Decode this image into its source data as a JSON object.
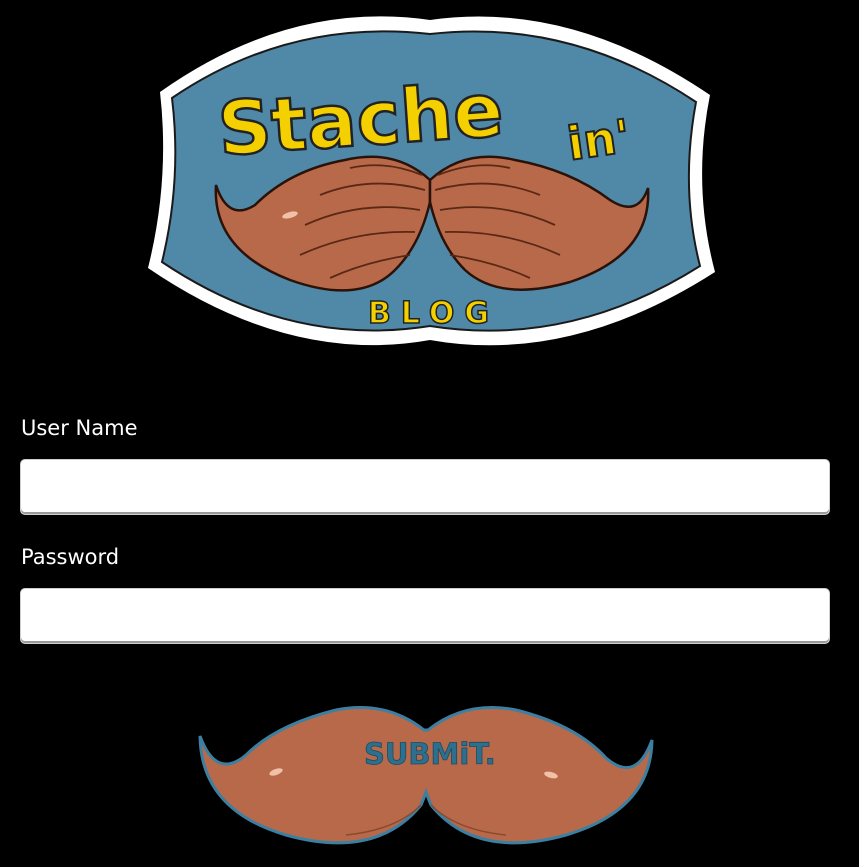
{
  "logo": {
    "word_main": "Stache",
    "word_suffix": "in'",
    "word_sub": "BLOG"
  },
  "form": {
    "username_label": "User Name",
    "username_value": "",
    "password_label": "Password",
    "password_value": "",
    "submit_label": "SUBMiT."
  },
  "colors": {
    "background": "#000000",
    "badge_fill": "#5089a8",
    "badge_border": "#ffffff",
    "lettering": "#f5d000",
    "mustache": "#b8694a",
    "mustache_dark": "#7a3a22",
    "submit_text": "#2d6f8c"
  },
  "icons": {
    "logo": "mustache-badge-logo",
    "submit": "mustache-submit-button"
  }
}
